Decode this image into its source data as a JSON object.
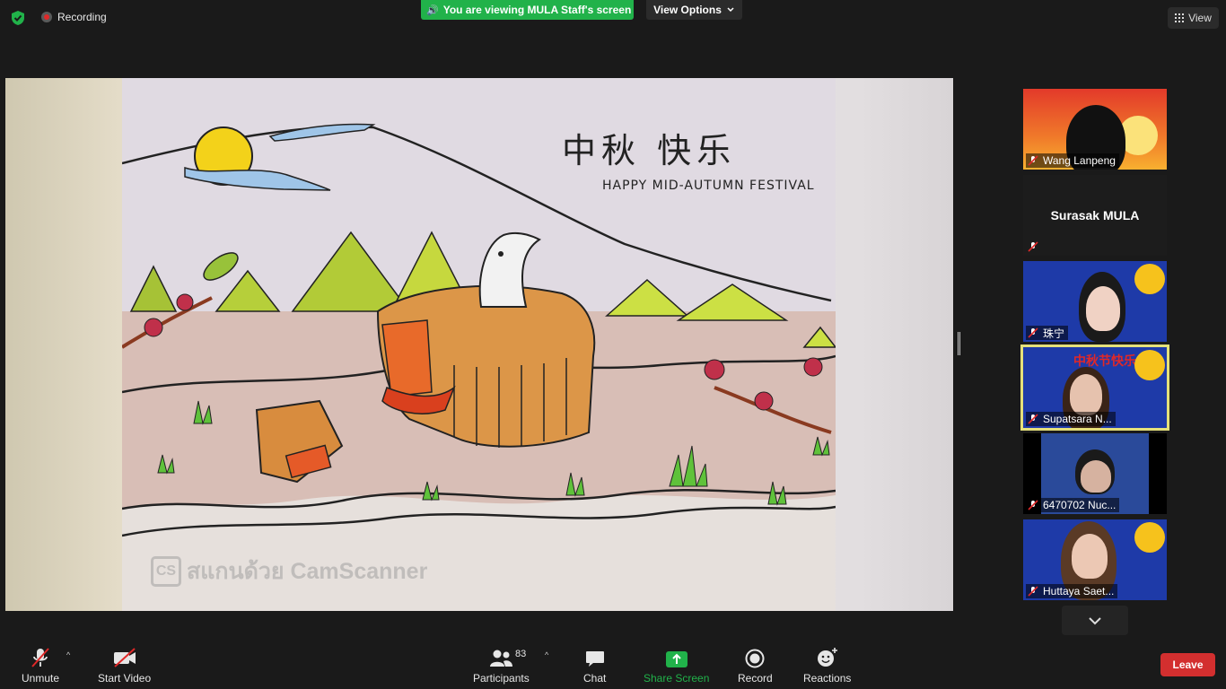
{
  "topbar": {
    "recording_label": "Recording",
    "viewing_banner": "You are viewing MULA Staff's screen",
    "view_options_label": "View Options",
    "view_label": "View"
  },
  "shared_content": {
    "drawing_title_cn": "中秋 快乐",
    "drawing_subtitle": "HAPPY MID-AUTUMN FESTIVAL",
    "watermark": "สแกนด้วย CamScanner",
    "watermark_logo": "CS"
  },
  "participants_panel": {
    "tiles": [
      {
        "name": "Wang Lanpeng",
        "muted": true,
        "video": true
      },
      {
        "name": "Surasak MULA",
        "muted": true,
        "video": false
      },
      {
        "name": "珠宁",
        "muted": true,
        "video": true
      },
      {
        "name": "Supatsara N...",
        "muted": true,
        "video": true,
        "active_speaker": true
      },
      {
        "name": "6470702 Nuc...",
        "muted": true,
        "video": true
      },
      {
        "name": "Huttaya Saet...",
        "muted": true,
        "video": true
      }
    ],
    "backdrop_text": "中秋节快乐"
  },
  "toolbar": {
    "unmute_label": "Unmute",
    "start_video_label": "Start Video",
    "participants_label": "Participants",
    "participants_count": "83",
    "chat_label": "Chat",
    "share_screen_label": "Share Screen",
    "record_label": "Record",
    "reactions_label": "Reactions",
    "leave_label": "Leave"
  },
  "colors": {
    "share_green": "#21b24a",
    "leave_red": "#d32f2f",
    "active_speaker": "#e5e07a",
    "background": "#1a1a1a"
  }
}
